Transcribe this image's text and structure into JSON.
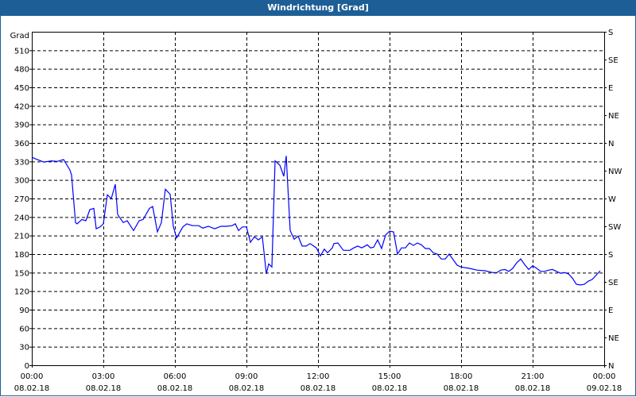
{
  "window": {
    "title": "Windrichtung [Grad]"
  },
  "chart_data": {
    "type": "line",
    "title": "Windrichtung [Grad]",
    "ylabel": "Grad",
    "xlabel": "",
    "ylim": [
      0,
      540
    ],
    "xlim_minutes": [
      0,
      1440
    ],
    "y_ticks": [
      0,
      30,
      60,
      90,
      120,
      150,
      180,
      210,
      240,
      270,
      300,
      330,
      360,
      390,
      420,
      450,
      480,
      510
    ],
    "right_ticks": [
      {
        "value": 540,
        "label": "S"
      },
      {
        "value": 495,
        "label": "SE"
      },
      {
        "value": 450,
        "label": "E"
      },
      {
        "value": 405,
        "label": "NE"
      },
      {
        "value": 360,
        "label": "N"
      },
      {
        "value": 315,
        "label": "NW"
      },
      {
        "value": 270,
        "label": "W"
      },
      {
        "value": 225,
        "label": "SW"
      },
      {
        "value": 180,
        "label": "S"
      },
      {
        "value": 135,
        "label": "SE"
      },
      {
        "value": 90,
        "label": "E"
      },
      {
        "value": 45,
        "label": "NE"
      },
      {
        "value": 0,
        "label": "N"
      }
    ],
    "x_ticks": [
      {
        "minutes": 0,
        "time": "00:00",
        "date": "08.02.18"
      },
      {
        "minutes": 180,
        "time": "03:00",
        "date": "08.02.18"
      },
      {
        "minutes": 360,
        "time": "06:00",
        "date": "08.02.18"
      },
      {
        "minutes": 540,
        "time": "09:00",
        "date": "08.02.18"
      },
      {
        "minutes": 720,
        "time": "12:00",
        "date": "08.02.18"
      },
      {
        "minutes": 900,
        "time": "15:00",
        "date": "08.02.18"
      },
      {
        "minutes": 1080,
        "time": "18:00",
        "date": "08.02.18"
      },
      {
        "minutes": 1260,
        "time": "21:00",
        "date": "08.02.18"
      },
      {
        "minutes": 1440,
        "time": "00:00",
        "date": "09.02.18"
      }
    ],
    "grid": true,
    "series": [
      {
        "name": "Windrichtung",
        "color": "#0000ff",
        "points": [
          [
            0,
            337
          ],
          [
            10,
            334
          ],
          [
            30,
            329
          ],
          [
            50,
            331
          ],
          [
            64,
            330
          ],
          [
            80,
            333
          ],
          [
            96,
            316
          ],
          [
            100,
            308
          ],
          [
            110,
            231
          ],
          [
            114,
            229
          ],
          [
            126,
            236
          ],
          [
            136,
            234
          ],
          [
            146,
            252
          ],
          [
            156,
            254
          ],
          [
            162,
            221
          ],
          [
            172,
            224
          ],
          [
            180,
            229
          ],
          [
            190,
            276
          ],
          [
            200,
            270
          ],
          [
            210,
            293
          ],
          [
            216,
            244
          ],
          [
            230,
            231
          ],
          [
            240,
            234
          ],
          [
            256,
            218
          ],
          [
            270,
            234
          ],
          [
            280,
            236
          ],
          [
            296,
            254
          ],
          [
            304,
            257
          ],
          [
            316,
            216
          ],
          [
            326,
            231
          ],
          [
            336,
            285
          ],
          [
            348,
            277
          ],
          [
            356,
            225
          ],
          [
            364,
            206
          ],
          [
            380,
            224
          ],
          [
            390,
            229
          ],
          [
            404,
            226
          ],
          [
            420,
            226
          ],
          [
            430,
            222
          ],
          [
            444,
            225
          ],
          [
            460,
            221
          ],
          [
            476,
            225
          ],
          [
            490,
            225
          ],
          [
            504,
            226
          ],
          [
            512,
            229
          ],
          [
            520,
            218
          ],
          [
            530,
            224
          ],
          [
            540,
            224
          ],
          [
            550,
            199
          ],
          [
            560,
            208
          ],
          [
            570,
            203
          ],
          [
            580,
            208
          ],
          [
            590,
            148
          ],
          [
            596,
            164
          ],
          [
            604,
            159
          ],
          [
            612,
            331
          ],
          [
            624,
            324
          ],
          [
            634,
            306
          ],
          [
            640,
            339
          ],
          [
            650,
            218
          ],
          [
            660,
            204
          ],
          [
            670,
            209
          ],
          [
            680,
            193
          ],
          [
            690,
            193
          ],
          [
            700,
            197
          ],
          [
            716,
            190
          ],
          [
            726,
            177
          ],
          [
            736,
            188
          ],
          [
            744,
            182
          ],
          [
            756,
            190
          ],
          [
            760,
            197
          ],
          [
            770,
            198
          ],
          [
            784,
            186
          ],
          [
            800,
            186
          ],
          [
            810,
            190
          ],
          [
            820,
            193
          ],
          [
            830,
            190
          ],
          [
            844,
            195
          ],
          [
            852,
            190
          ],
          [
            860,
            191
          ],
          [
            870,
            203
          ],
          [
            880,
            189
          ],
          [
            890,
            211
          ],
          [
            900,
            217
          ],
          [
            910,
            216
          ],
          [
            920,
            180
          ],
          [
            930,
            190
          ],
          [
            940,
            190
          ],
          [
            950,
            198
          ],
          [
            960,
            194
          ],
          [
            970,
            198
          ],
          [
            980,
            195
          ],
          [
            990,
            189
          ],
          [
            1000,
            189
          ],
          [
            1010,
            182
          ],
          [
            1020,
            180
          ],
          [
            1030,
            172
          ],
          [
            1040,
            172
          ],
          [
            1050,
            180
          ],
          [
            1060,
            171
          ],
          [
            1070,
            162
          ],
          [
            1080,
            159
          ],
          [
            1100,
            157
          ],
          [
            1120,
            154
          ],
          [
            1140,
            153
          ],
          [
            1160,
            150
          ],
          [
            1170,
            150
          ],
          [
            1180,
            154
          ],
          [
            1190,
            155
          ],
          [
            1200,
            152
          ],
          [
            1210,
            157
          ],
          [
            1220,
            166
          ],
          [
            1230,
            172
          ],
          [
            1240,
            163
          ],
          [
            1250,
            155
          ],
          [
            1260,
            161
          ],
          [
            1270,
            157
          ],
          [
            1280,
            152
          ],
          [
            1290,
            152
          ],
          [
            1300,
            154
          ],
          [
            1310,
            155
          ],
          [
            1320,
            152
          ],
          [
            1330,
            149
          ],
          [
            1340,
            150
          ],
          [
            1350,
            148
          ],
          [
            1360,
            141
          ],
          [
            1370,
            131
          ],
          [
            1380,
            130
          ],
          [
            1390,
            131
          ],
          [
            1400,
            136
          ],
          [
            1410,
            139
          ],
          [
            1420,
            146
          ],
          [
            1430,
            153
          ]
        ]
      }
    ]
  }
}
